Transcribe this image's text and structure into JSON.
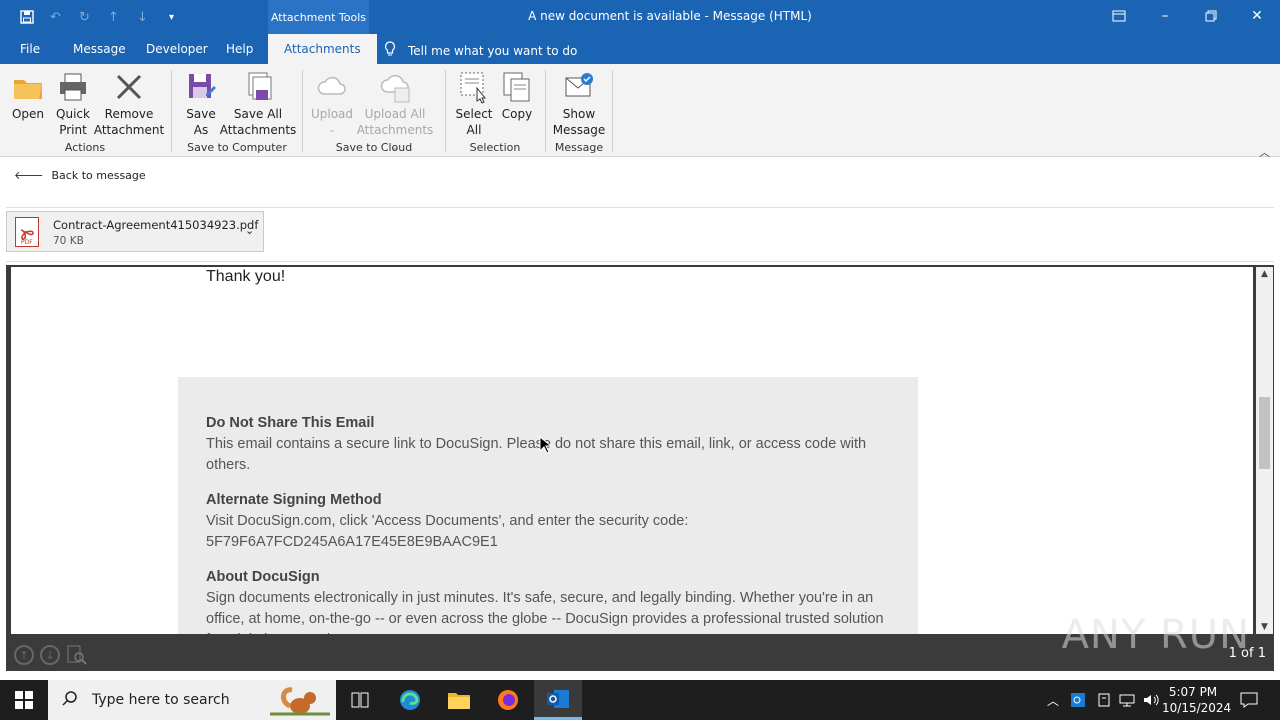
{
  "window": {
    "title": "A new document is available  -  Message (HTML)",
    "context_tab": "Attachment Tools"
  },
  "ribbon_tabs": [
    "File",
    "Message",
    "Developer",
    "Help",
    "Attachments"
  ],
  "tell_me": "Tell me what you want to do",
  "ribbon": {
    "open": "Open",
    "quick_print": [
      "Quick",
      "Print"
    ],
    "remove_attachment": [
      "Remove",
      "Attachment"
    ],
    "group_actions": "Actions",
    "save_as": [
      "Save",
      "As"
    ],
    "save_all": [
      "Save All",
      "Attachments"
    ],
    "group_save_computer": "Save to Computer",
    "upload": "Upload",
    "upload_all": [
      "Upload All",
      "Attachments"
    ],
    "group_save_cloud": "Save to Cloud",
    "select_all": [
      "Select",
      "All"
    ],
    "copy": "Copy",
    "group_selection": "Selection",
    "show_message": [
      "Show",
      "Message"
    ],
    "group_message": "Message"
  },
  "back_to_message": "Back to message",
  "attachment": {
    "name": "Contract-Agreement415034923.pdf",
    "size": "70 KB",
    "icon_label": "PDF"
  },
  "document": {
    "thanks": "Thank you!",
    "sections": [
      {
        "heading": "Do Not Share This Email",
        "body": "This email contains a secure link to DocuSign. Please do not share this email, link, or access code with others."
      },
      {
        "heading": "Alternate Signing Method",
        "body": "Visit DocuSign.com, click 'Access Documents', and enter the security code: 5F79F6A7FCD245A6A17E45E8E9BAAC9E1"
      },
      {
        "heading": "About DocuSign",
        "body": "Sign documents electronically in just minutes. It's safe, secure, and legally binding. Whether you're in an office, at home, on-the-go -- or even across the globe -- DocuSign provides a professional trusted solution for Digital Transaction Management™."
      }
    ]
  },
  "page_info": "1 of 1",
  "watermark": "ANY RUN",
  "taskbar": {
    "search_placeholder": "Type here to search",
    "time": "5:07 PM",
    "date": "10/15/2024"
  },
  "colors": {
    "accent": "#1b64b4",
    "taskbar": "#1e1e1e"
  }
}
